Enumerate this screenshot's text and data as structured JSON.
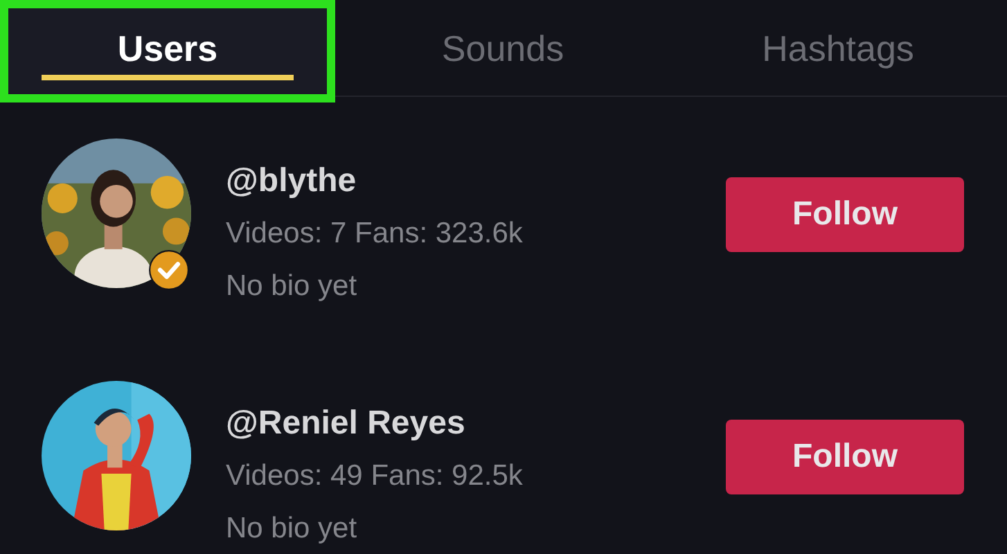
{
  "tabs": [
    {
      "label": "Users",
      "selected": true,
      "highlighted": true
    },
    {
      "label": "Sounds",
      "selected": false,
      "highlighted": false
    },
    {
      "label": "Hashtags",
      "selected": false,
      "highlighted": false
    }
  ],
  "users": [
    {
      "handle": "@blythe",
      "stats": "Videos: 7 Fans: 323.6k",
      "bio": "No bio yet",
      "verified": true,
      "button": "Follow"
    },
    {
      "handle": "@Reniel Reyes",
      "stats": "Videos: 49 Fans: 92.5k",
      "bio": "No bio yet",
      "verified": false,
      "button": "Follow"
    }
  ]
}
